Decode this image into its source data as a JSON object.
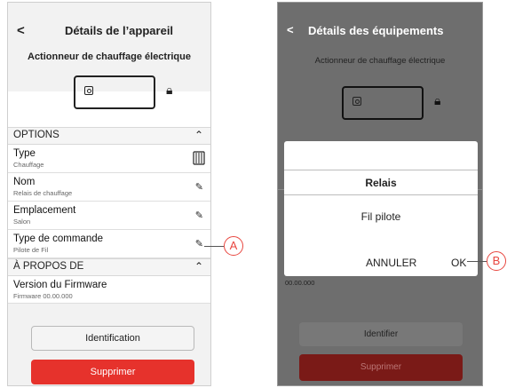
{
  "left_screen": {
    "back_label": "<",
    "title": "Détails de l’appareil",
    "subtitle": "Actionneur de chauffage électrique",
    "options_header": "OPTIONS",
    "rows": [
      {
        "title": "Type",
        "subtitle": "Chauffage",
        "icon": "radiator-icon"
      },
      {
        "title": "Nom",
        "subtitle": "Relais de chauffage",
        "icon": "pencil-icon"
      },
      {
        "title": "Emplacement",
        "subtitle": "Salon",
        "icon": "pencil-icon"
      },
      {
        "title": "Type de commande",
        "subtitle": "Pilote de Fil",
        "icon": "pencil-icon"
      }
    ],
    "about_header": "À PROPOS DE",
    "firmware_title": "Version du Firmware",
    "firmware_value": "Firmware 00.00.000",
    "identify_button": "Identification",
    "delete_button": "Supprimer"
  },
  "right_screen": {
    "back_label": "<",
    "title": "Détails des équipements",
    "subtitle": "Actionneur de chauffage électrique",
    "partial_value": "00.00.000",
    "identify_button": "Identifier",
    "delete_button": "Supprimer",
    "dialog": {
      "title": "Relais",
      "option": "Fil pilote",
      "cancel": "ANNULER",
      "ok": "OK"
    }
  },
  "callouts": {
    "a": "A",
    "b": "B"
  },
  "colors": {
    "accent_red": "#e6322c",
    "callout": "#e8463f",
    "overlay": "#6e6e6e"
  }
}
